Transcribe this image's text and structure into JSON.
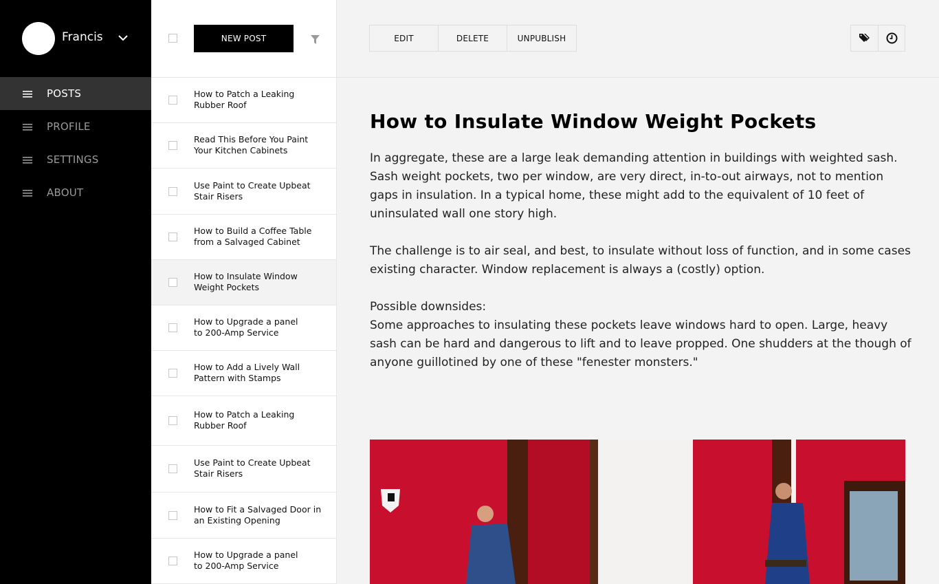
{
  "user": {
    "name": "Francis"
  },
  "nav": {
    "items": [
      {
        "label": "POSTS",
        "active": true
      },
      {
        "label": "PROFILE",
        "active": false
      },
      {
        "label": "SETTINGS",
        "active": false
      },
      {
        "label": "ABOUT",
        "active": false
      }
    ]
  },
  "list": {
    "new_post_label": "NEW POST",
    "posts": [
      {
        "title": "How to Patch a Leaking\nRubber Roof",
        "selected": false
      },
      {
        "title": "Read This Before You Paint\nYour Kitchen Cabinets",
        "selected": false
      },
      {
        "title": "Use Paint to Create Upbeat\nStair Risers",
        "selected": false
      },
      {
        "title": "How to Build a Coffee Table\nfrom a Salvaged Cabinet",
        "selected": false
      },
      {
        "title": "How to Insulate Window\nWeight Pockets",
        "selected": true
      },
      {
        "title": "How to Upgrade a panel\nto 200-Amp Service",
        "selected": false
      },
      {
        "title": "How to Add a Lively Wall\nPattern with Stamps",
        "selected": false
      },
      {
        "title": "How to Patch a Leaking\nRubber Roof",
        "selected": false
      },
      {
        "title": "Use Paint to Create Upbeat\nStair Risers",
        "selected": false
      },
      {
        "title": "How to Fit a Salvaged Door in\nan Existing Opening",
        "selected": false
      },
      {
        "title": "How to Upgrade a panel\nto 200-Amp Service",
        "selected": false
      }
    ]
  },
  "toolbar": {
    "edit_label": "EDIT",
    "delete_label": "DELETE",
    "unpublish_label": "UNPUBLISH",
    "icons": [
      "tags-icon",
      "clock-icon"
    ]
  },
  "article": {
    "title": "How to Insulate Window Weight Pockets",
    "paragraph1": "In aggregate, these are a large leak demanding attention in buildings with weighted sash. Sash weight pockets, two per window, are very direct, in-to-out airways, not to mention gaps in insulation. In a typical home, these might add to the equivalent of 10 feet of uninsulated wall one story high.",
    "paragraph2": "The challenge is to air seal, and best, to insulate without loss of function, and in some cases existing character. Window replacement is always a (costly) option.",
    "subhead": "Possible downsides:",
    "paragraph3": "Some approaches to insulating these pockets leave windows hard to open. Large, heavy sash can be hard and dangerous to lift and to leave propped. One shudders at the though of anyone guillotined by one of these \"fenester monsters.\""
  },
  "colors": {
    "sidebar_bg": "#000000",
    "sidebar_active": "#333333",
    "content_bg": "#f3f3f3",
    "wall_red": "#c8102e"
  }
}
